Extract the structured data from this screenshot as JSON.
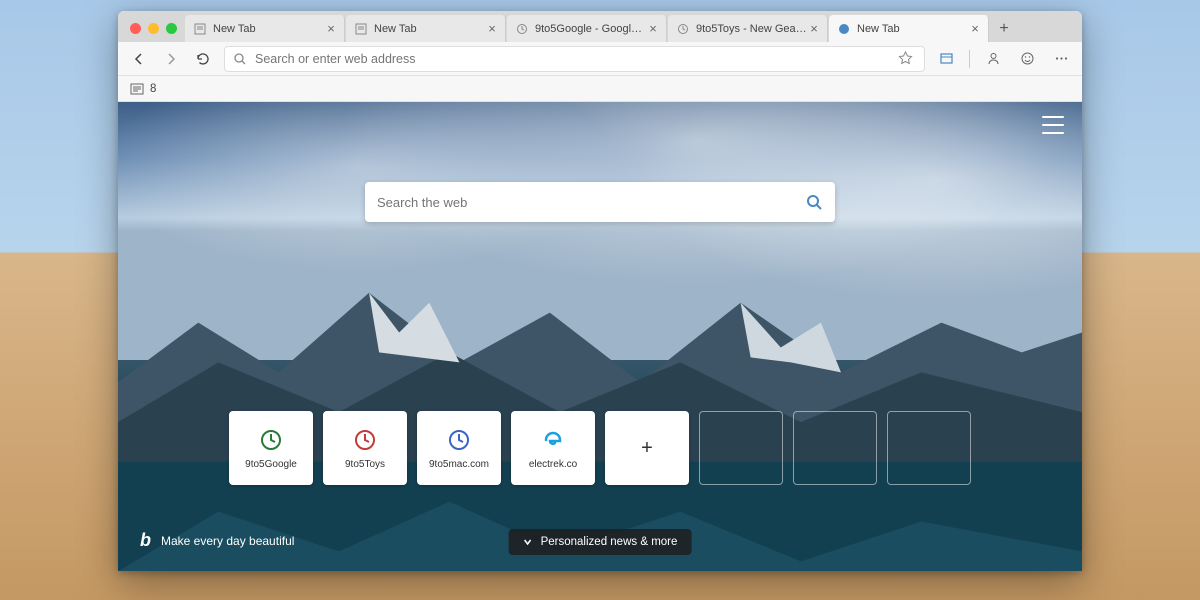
{
  "tabs": [
    {
      "label": "New Tab",
      "icon": "page",
      "active": false
    },
    {
      "label": "New Tab",
      "icon": "page",
      "active": false
    },
    {
      "label": "9to5Google - Google ne…",
      "icon": "clock",
      "active": false
    },
    {
      "label": "9to5Toys - New Gear, rev…",
      "icon": "clock",
      "active": false
    },
    {
      "label": "New Tab",
      "icon": "edge",
      "active": true
    }
  ],
  "toolbar": {
    "address_placeholder": "Search or enter web address"
  },
  "bookmarks_bar": {
    "count_label": "8"
  },
  "ntp": {
    "search_placeholder": "Search the web",
    "tiles": [
      {
        "label": "9to5Google",
        "icon": "clock-green"
      },
      {
        "label": "9to5Toys",
        "icon": "clock-red"
      },
      {
        "label": "9to5mac.com",
        "icon": "clock-blue"
      },
      {
        "label": "electrek.co",
        "icon": "edge-e"
      }
    ],
    "bing_tagline": "Make every day beautiful",
    "news_button": "Personalized news & more"
  }
}
